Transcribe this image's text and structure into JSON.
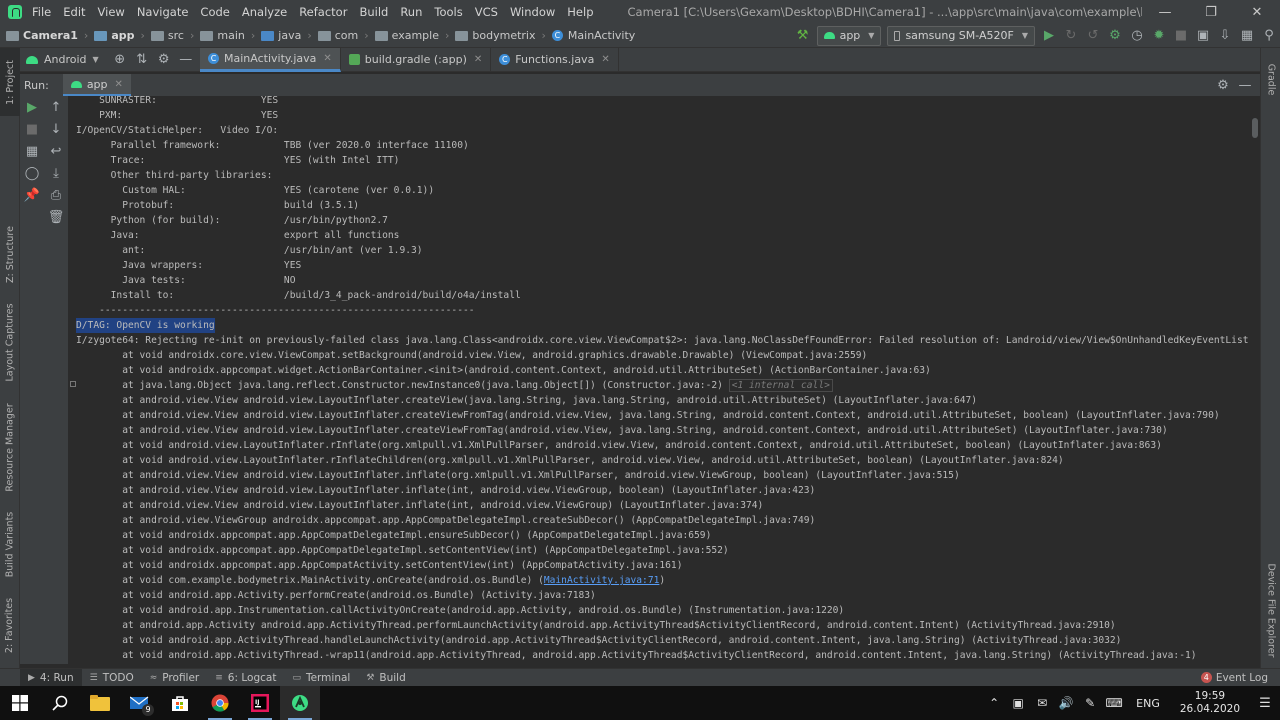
{
  "menubar": {
    "items": [
      "File",
      "Edit",
      "View",
      "Navigate",
      "Code",
      "Analyze",
      "Refactor",
      "Build",
      "Run",
      "Tools",
      "VCS",
      "Window",
      "Help"
    ],
    "title": "Camera1 [C:\\Users\\Gexam\\Desktop\\BDHI\\Camera1] - ...\\app\\src\\main\\java\\com\\example\\bodymetrix\\MainActivity.java [app] - Android Studio",
    "controls": {
      "minimize": "—",
      "maximize": "❐",
      "close": "✕"
    }
  },
  "navbar": {
    "crumbs": [
      "Camera1",
      "app",
      "src",
      "main",
      "java",
      "com",
      "example",
      "bodymetrix",
      "MainActivity"
    ],
    "run_config": "app",
    "device": "samsung SM-A520F",
    "colors": {
      "folder": "#87939a",
      "module_folder": "#6897bb",
      "source_folder": "#4a88c7"
    }
  },
  "left_strip": {
    "tabs": [
      "1: Project",
      "Z: Structure",
      "Layout Captures",
      "Resource Manager",
      "Build Variants",
      "2: Favorites"
    ]
  },
  "right_strip": {
    "tabs": [
      "Gradle",
      "Device File Explorer"
    ]
  },
  "editor": {
    "project_view": "Android",
    "tabs": [
      {
        "label": "MainActivity.java",
        "active": true
      },
      {
        "label": "build.gradle (:app)",
        "active": false
      },
      {
        "label": "Functions.java",
        "active": false
      }
    ]
  },
  "run_panel": {
    "label": "Run:",
    "tab": "app"
  },
  "console": {
    "lines": [
      {
        "text": "    SUNRASTER:                  YES"
      },
      {
        "text": "    PXM:                        YES"
      },
      {
        "text": "I/OpenCV/StaticHelper:   Video I/O:"
      },
      {
        "text": "      Parallel framework:           TBB (ver 2020.0 interface 11100)"
      },
      {
        "text": "      Trace:                        YES (with Intel ITT)"
      },
      {
        "text": "      Other third-party libraries:"
      },
      {
        "text": "        Custom HAL:                 YES (carotene (ver 0.0.1))"
      },
      {
        "text": "        Protobuf:                   build (3.5.1)"
      },
      {
        "text": "      Python (for build):           /usr/bin/python2.7"
      },
      {
        "text": "      Java:                         export all functions"
      },
      {
        "text": "        ant:                        /usr/bin/ant (ver 1.9.3)"
      },
      {
        "text": "        Java wrappers:              YES"
      },
      {
        "text": "        Java tests:                 NO"
      },
      {
        "text": "      Install to:                   /build/3_4_pack-android/build/o4a/install"
      },
      {
        "text": "    -----------------------------------------------------------------"
      },
      {
        "text": "D/TAG: OpenCV is working",
        "selected": true
      },
      {
        "text": "I/zygote64: Rejecting re-init on previously-failed class java.lang.Class<androidx.core.view.ViewCompat$2>: java.lang.NoClassDefFoundError: Failed resolution of: Landroid/view/View$OnUnhandledKeyEventListener;"
      },
      {
        "text": "        at void androidx.core.view.ViewCompat.setBackground(android.view.View, android.graphics.drawable.Drawable) (ViewCompat.java:2559)"
      },
      {
        "text": "        at void androidx.appcompat.widget.ActionBarContainer.<init>(android.content.Context, android.util.AttributeSet) (ActionBarContainer.java:63)"
      },
      {
        "text": "        at java.lang.Object java.lang.reflect.Constructor.newInstance0(java.lang.Object[]) (Constructor.java:-2) ",
        "fold": "<1 internal call>"
      },
      {
        "text": "        at android.view.View android.view.LayoutInflater.createView(java.lang.String, java.lang.String, android.util.AttributeSet) (LayoutInflater.java:647)"
      },
      {
        "text": "        at android.view.View android.view.LayoutInflater.createViewFromTag(android.view.View, java.lang.String, android.content.Context, android.util.AttributeSet, boolean) (LayoutInflater.java:790)"
      },
      {
        "text": "        at android.view.View android.view.LayoutInflater.createViewFromTag(android.view.View, java.lang.String, android.content.Context, android.util.AttributeSet) (LayoutInflater.java:730)"
      },
      {
        "text": "        at void android.view.LayoutInflater.rInflate(org.xmlpull.v1.XmlPullParser, android.view.View, android.content.Context, android.util.AttributeSet, boolean) (LayoutInflater.java:863)"
      },
      {
        "text": "        at void android.view.LayoutInflater.rInflateChildren(org.xmlpull.v1.XmlPullParser, android.view.View, android.util.AttributeSet, boolean) (LayoutInflater.java:824)"
      },
      {
        "text": "        at android.view.View android.view.LayoutInflater.inflate(org.xmlpull.v1.XmlPullParser, android.view.ViewGroup, boolean) (LayoutInflater.java:515)"
      },
      {
        "text": "        at android.view.View android.view.LayoutInflater.inflate(int, android.view.ViewGroup, boolean) (LayoutInflater.java:423)"
      },
      {
        "text": "        at android.view.View android.view.LayoutInflater.inflate(int, android.view.ViewGroup) (LayoutInflater.java:374)"
      },
      {
        "text": "        at android.view.ViewGroup androidx.appcompat.app.AppCompatDelegateImpl.createSubDecor() (AppCompatDelegateImpl.java:749)"
      },
      {
        "text": "        at void androidx.appcompat.app.AppCompatDelegateImpl.ensureSubDecor() (AppCompatDelegateImpl.java:659)"
      },
      {
        "text": "        at void androidx.appcompat.app.AppCompatDelegateImpl.setContentView(int) (AppCompatDelegateImpl.java:552)"
      },
      {
        "text": "        at void androidx.appcompat.app.AppCompatActivity.setContentView(int) (AppCompatActivity.java:161)"
      },
      {
        "text": "        at void com.example.bodymetrix.MainActivity.onCreate(android.os.Bundle) (",
        "link": "MainActivity.java:71",
        "after": ")"
      },
      {
        "text": "        at void android.app.Activity.performCreate(android.os.Bundle) (Activity.java:7183)"
      },
      {
        "text": "        at void android.app.Instrumentation.callActivityOnCreate(android.app.Activity, android.os.Bundle) (Instrumentation.java:1220)"
      },
      {
        "text": "        at android.app.Activity android.app.ActivityThread.performLaunchActivity(android.app.ActivityThread$ActivityClientRecord, android.content.Intent) (ActivityThread.java:2910)"
      },
      {
        "text": "        at void android.app.ActivityThread.handleLaunchActivity(android.app.ActivityThread$ActivityClientRecord, android.content.Intent, java.lang.String) (ActivityThread.java:3032)"
      },
      {
        "text": "        at void android.app.ActivityThread.-wrap11(android.app.ActivityThread, android.app.ActivityThread$ActivityClientRecord, android.content.Intent, java.lang.String) (ActivityThread.java:-1)"
      }
    ]
  },
  "bottom_bar": {
    "tabs": [
      {
        "label": "4: Run",
        "icon": "run-icon",
        "active": true
      },
      {
        "label": "TODO",
        "icon": "list-icon"
      },
      {
        "label": "Profiler",
        "icon": "profiler-icon"
      },
      {
        "label": "6: Logcat",
        "icon": "logcat-icon"
      },
      {
        "label": "Terminal",
        "icon": "terminal-icon"
      },
      {
        "label": "Build",
        "icon": "build-icon"
      }
    ],
    "event_log": {
      "count": "4",
      "label": "Event Log"
    }
  },
  "taskbar": {
    "mail_badge": "9",
    "language": "ENG",
    "time": "19:59",
    "date": "26.04.2020"
  }
}
